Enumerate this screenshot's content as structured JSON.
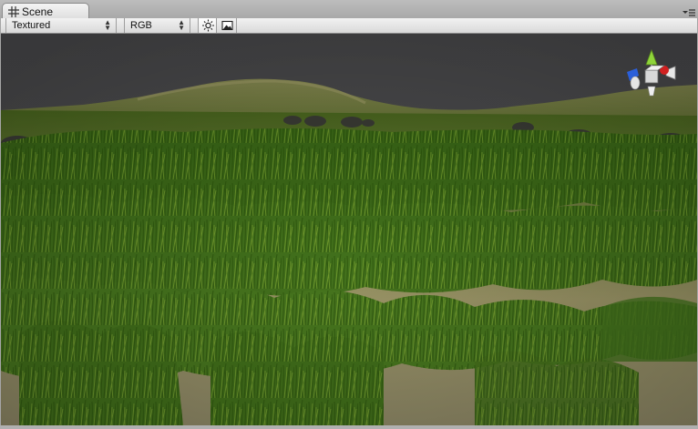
{
  "tab": {
    "label": "Scene",
    "icon": "grid-icon"
  },
  "panel_menu": {
    "icon": "panel-menu-icon"
  },
  "toolbar": {
    "draw_mode": "Textured",
    "render_mode": "RGB",
    "lighting_icon": "sun-icon",
    "image_icon": "image-icon"
  },
  "gizmo": {
    "icon": "scene-gizmo-icon"
  },
  "colors": {
    "sky": "#4a4a4c",
    "grass": "#3f6d16",
    "ground": "#9c9367",
    "gizmo_y": "#8fd43a",
    "gizmo_x": "#d02020",
    "gizmo_z": "#2b5fd9"
  }
}
